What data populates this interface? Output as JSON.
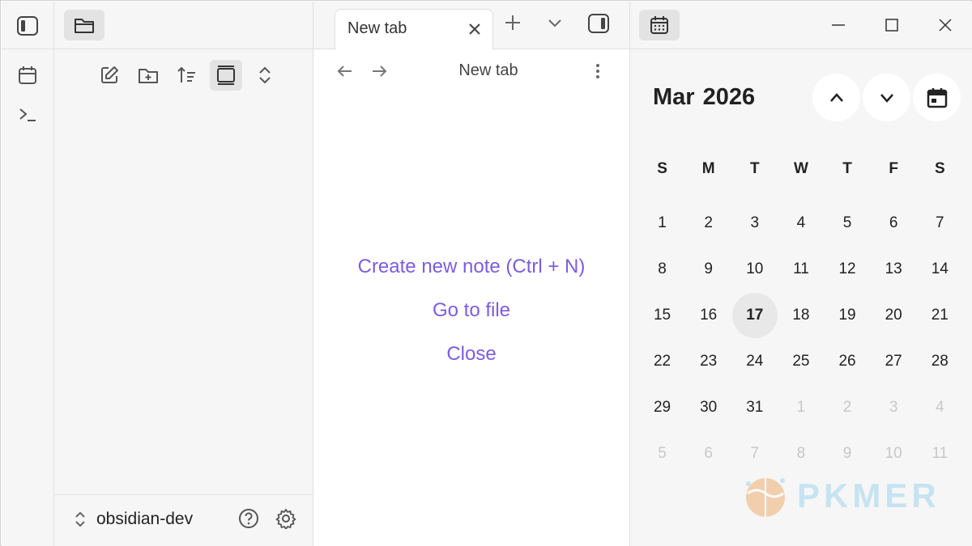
{
  "ribbon": {
    "icons": [
      "sidebar-toggle-icon",
      "calendar-icon",
      "terminal-icon"
    ]
  },
  "sidebar": {
    "tab_icon": "folder-icon",
    "nav_buttons": [
      "new-note-icon",
      "new-folder-icon",
      "sort-icon",
      "collapse-view-icon",
      "expand-collapse-icon"
    ],
    "vault_name": "obsidian-dev"
  },
  "main": {
    "tab_label": "New tab",
    "view_title": "New tab",
    "actions": {
      "create": "Create new note (Ctrl + N)",
      "goto": "Go to file",
      "close": "Close"
    }
  },
  "calendar": {
    "month": "Mar",
    "year": "2026",
    "weekdays": [
      "S",
      "M",
      "T",
      "W",
      "T",
      "F",
      "S"
    ],
    "weeks": [
      [
        "1",
        "2",
        "3",
        "4",
        "5",
        "6",
        "7"
      ],
      [
        "8",
        "9",
        "10",
        "11",
        "12",
        "13",
        "14"
      ],
      [
        "15",
        "16",
        "17",
        "18",
        "19",
        "20",
        "21"
      ],
      [
        "22",
        "23",
        "24",
        "25",
        "26",
        "27",
        "28"
      ],
      [
        "29",
        "30",
        "31",
        "1",
        "2",
        "3",
        "4"
      ],
      [
        "5",
        "6",
        "7",
        "8",
        "9",
        "10",
        "11"
      ]
    ],
    "today": "17"
  },
  "watermark": "PKMER",
  "colors": {
    "accent": "#7c5ce0"
  }
}
